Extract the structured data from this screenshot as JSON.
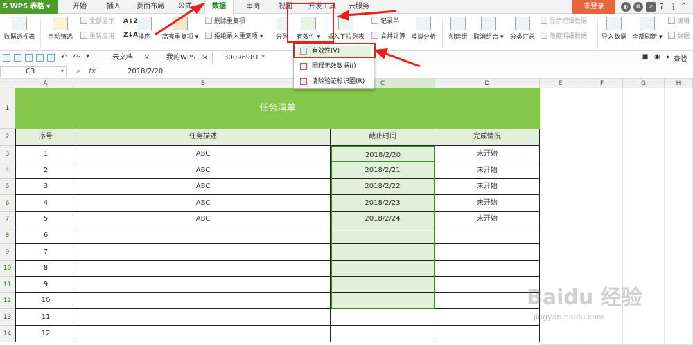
{
  "app": {
    "name": "WPS 表格"
  },
  "menu_tabs": [
    "开始",
    "插入",
    "页面布局",
    "公式",
    "数据",
    "审阅",
    "视图",
    "开发工具",
    "云服务"
  ],
  "login_label": "未登录",
  "ribbon": {
    "pivot": "数据透视表",
    "autofilter": "自动筛选",
    "show_all": "全部显示",
    "reapply": "重新应用",
    "sort": "排序",
    "highlight_dup": "高亮重复项",
    "delete_dup": "删除重复项",
    "reject_dup": "拒绝录入重复项",
    "split": "分列",
    "validity": "有效性",
    "insert_dropdown": "插入下拉列表",
    "record_form": "记录单",
    "consolidate": "合并计算",
    "what_if": "模拟分析",
    "create_group": "创建组",
    "ungroup": "取消组合",
    "subtotal": "分类汇总",
    "show_detail": "显示明细数据",
    "hide_detail": "隐藏明细数据",
    "import_data": "导入数据",
    "refresh_all": "全部刷新",
    "edit": "编辑",
    "data": "数据"
  },
  "dropdown": {
    "items": [
      "有效性(V)",
      "圈释无效数据(I)",
      "清除验证标识圈(R)"
    ]
  },
  "file_tabs": [
    "云文档",
    "我的WPS",
    "30096981 *"
  ],
  "search_label": "查找",
  "formula_bar": {
    "cell_ref": "C3",
    "fx": "fx",
    "value": "2018/2/20"
  },
  "columns": [
    "A",
    "B",
    "C",
    "D",
    "E",
    "F",
    "G",
    "H"
  ],
  "rows": [
    "1",
    "2",
    "3",
    "4",
    "5",
    "6",
    "7",
    "8",
    "9",
    "10",
    "11",
    "12",
    "13",
    "14"
  ],
  "sheet": {
    "title": "任务清单",
    "headers": [
      "序号",
      "任务描述",
      "截止时间",
      "完成情况"
    ],
    "data": [
      [
        "1",
        "ABC",
        "2018/2/20",
        "未开始"
      ],
      [
        "2",
        "ABC",
        "2018/2/21",
        "未开始"
      ],
      [
        "3",
        "ABC",
        "2018/2/22",
        "未开始"
      ],
      [
        "4",
        "ABC",
        "2018/2/23",
        "未开始"
      ],
      [
        "5",
        "ABC",
        "2018/2/24",
        "未开始"
      ],
      [
        "6",
        "",
        "",
        ""
      ],
      [
        "7",
        "",
        "",
        ""
      ],
      [
        "8",
        "",
        "",
        ""
      ],
      [
        "9",
        "",
        "",
        ""
      ],
      [
        "10",
        "",
        "",
        ""
      ],
      [
        "11",
        "",
        "",
        ""
      ],
      [
        "12",
        "",
        "",
        ""
      ]
    ]
  },
  "watermark": {
    "text": "Baidu 经验",
    "url": "jingyan.baidu.com"
  },
  "colors": {
    "header_green": "#84c84c",
    "selection": "#e2efda",
    "annotation_red": "#e8211f",
    "login": "#e8643a"
  }
}
